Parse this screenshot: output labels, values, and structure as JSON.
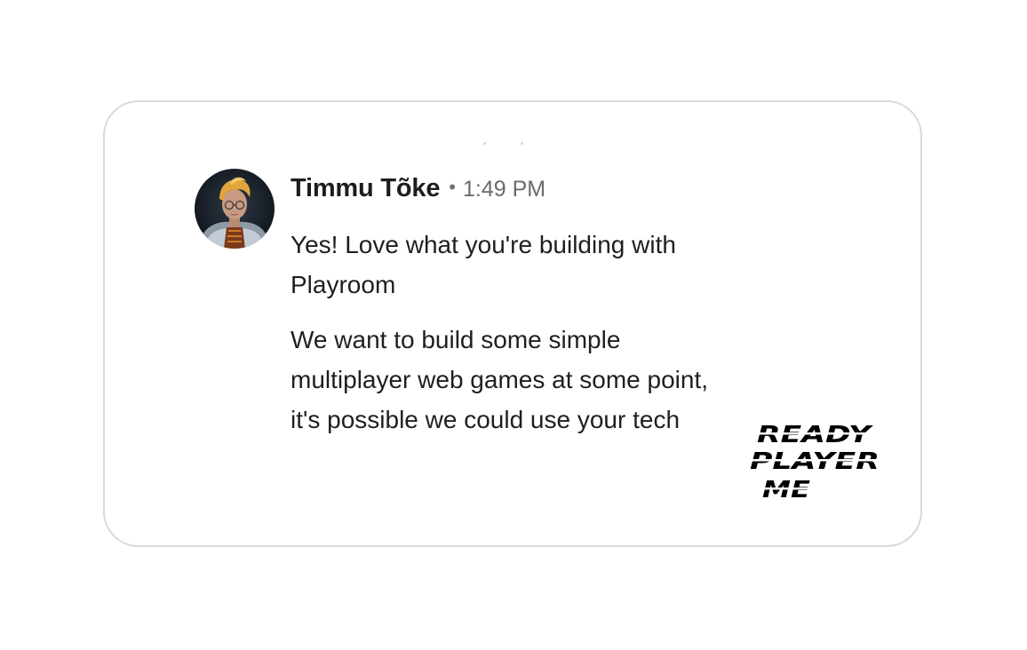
{
  "message": {
    "author": "Timmu Tõke",
    "separator": "•",
    "time": "1:49 PM",
    "paragraphs": [
      "Yes! Love what you're building with Playroom",
      "We want to build some simple multiplayer web games at some point, it's possible we could use your tech"
    ]
  },
  "logo": {
    "lines": [
      "READY",
      "PLAYER",
      "ME"
    ]
  },
  "colors": {
    "card_border": "#d9d9d9",
    "text": "#1f1f1f",
    "muted": "#6b6b6b",
    "logo": "#000000"
  }
}
